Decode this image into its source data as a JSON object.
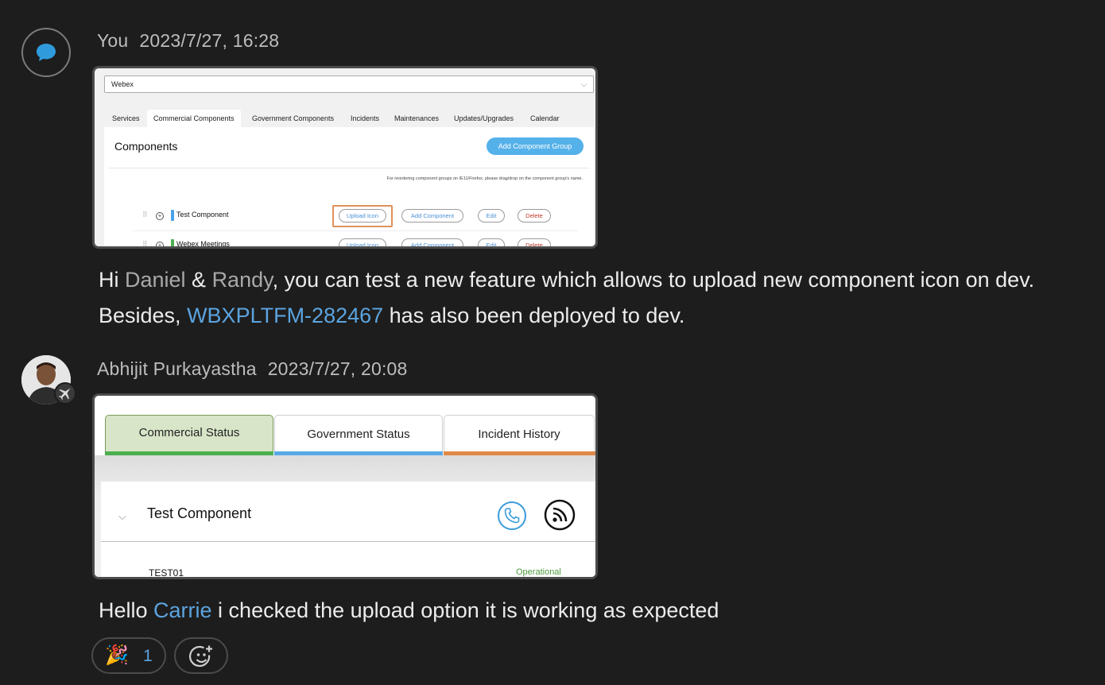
{
  "messages": [
    {
      "sender": "You",
      "timestamp": "2023/7/27, 16:28",
      "avatar_icon": "chat-bubble-icon",
      "attachment": {
        "product_select": "Webex",
        "tabs": [
          "Services",
          "Commercial Components",
          "Government Components",
          "Incidents",
          "Maintenances",
          "Updates/Upgrades",
          "Calendar"
        ],
        "active_tab": "Commercial Components",
        "section_title": "Components",
        "add_group_button": "Add Component Group",
        "reorder_note": "For reordering component groups on IE11/Firefox, please drag/drop on the component group's name.",
        "rows": [
          {
            "name": "Test Component",
            "color": "#4aa3e8"
          },
          {
            "name": "Webex Meetings",
            "color": "#4caf50"
          }
        ],
        "row_buttons": [
          "Upload Icon",
          "Add Component",
          "Edit",
          "Delete"
        ]
      },
      "text": {
        "p1": "Hi ",
        "mention1": "Daniel",
        "p2": " & ",
        "mention2": "Randy",
        "p3": ", you can test a new feature which allows to upload new component icon on dev.",
        "p4": "Besides, ",
        "link": "WBXPLTFM-282467",
        "p5": " has also been deployed to dev."
      }
    },
    {
      "sender": "Abhijit Purkayastha",
      "timestamp": "2023/7/27, 20:08",
      "presence_icon": "airplane-icon",
      "attachment": {
        "tabs": [
          {
            "label": "Commercial Status",
            "color": "#4caf50"
          },
          {
            "label": "Government Status",
            "color": "#5aa9e6"
          },
          {
            "label": "Incident History",
            "color": "#e08a48"
          }
        ],
        "component_name": "Test Component",
        "icons": [
          "phone-icon",
          "feed-icon"
        ],
        "item_name": "TEST01",
        "item_status": "Operational"
      },
      "text": {
        "p1": "Hello ",
        "mention": "Carrie",
        "p2": " i checked the upload option it is working as expected"
      },
      "reactions": [
        {
          "emoji": "🎉",
          "count": "1",
          "icon": "party-popper-icon"
        }
      ],
      "add_reaction_icon": "add-reaction-icon"
    }
  ]
}
